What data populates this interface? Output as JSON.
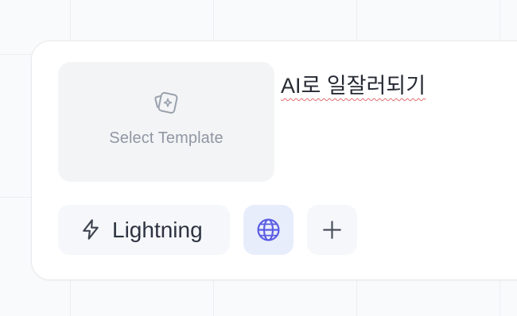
{
  "template_picker": {
    "label": "Select Template",
    "icon": "template-sparkle-icon"
  },
  "prompt": {
    "text": "AI로 일잘러되기"
  },
  "toolbar": {
    "mode_label": "Lightning",
    "mode_icon": "lightning-icon",
    "globe_icon": "globe-icon",
    "add_icon": "plus-icon"
  },
  "colors": {
    "globe_active_bg": "#e8edfc",
    "globe_icon": "#5b5ce2",
    "spellcheck_underline": "#e26a6a"
  }
}
